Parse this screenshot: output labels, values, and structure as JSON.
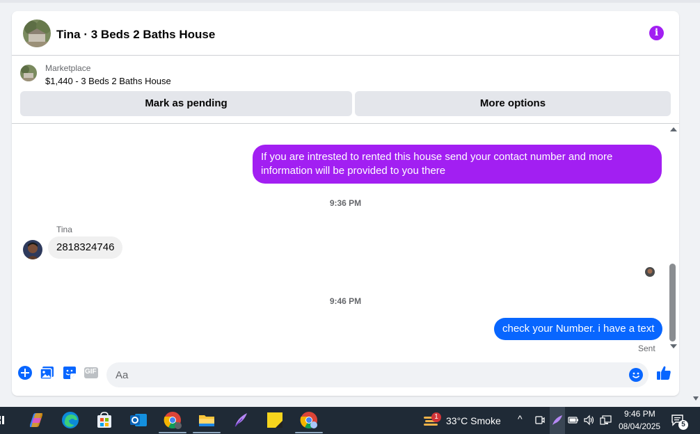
{
  "header": {
    "title": "Tina · 3 Beds 2 Baths House",
    "info_icon": "info-icon"
  },
  "marketplace": {
    "label": "Marketplace",
    "listing": "$1,440 - 3 Beds 2 Baths House",
    "mark_pending": "Mark as pending",
    "more_options": "More options"
  },
  "messages": {
    "outgoing_1": "If you are intrested to rented this house send your contact number and more information will be provided to you there",
    "timestamp_1": "9:36 PM",
    "sender_name": "Tina",
    "incoming_1": "2818324746",
    "timestamp_2": "9:46 PM",
    "outgoing_2": "check your Number. i have a text",
    "status": "Sent"
  },
  "composer": {
    "placeholder": "Aa",
    "gif_label": "GIF"
  },
  "taskbar": {
    "notification_count": "1",
    "weather": "33°C  Smoke",
    "time": "9:46 PM",
    "date": "08/04/2025",
    "chat_badge": "5"
  },
  "colors": {
    "accent_purple": "#a21ff2",
    "accent_blue": "#0866ff",
    "taskbar": "#1f2a36"
  }
}
